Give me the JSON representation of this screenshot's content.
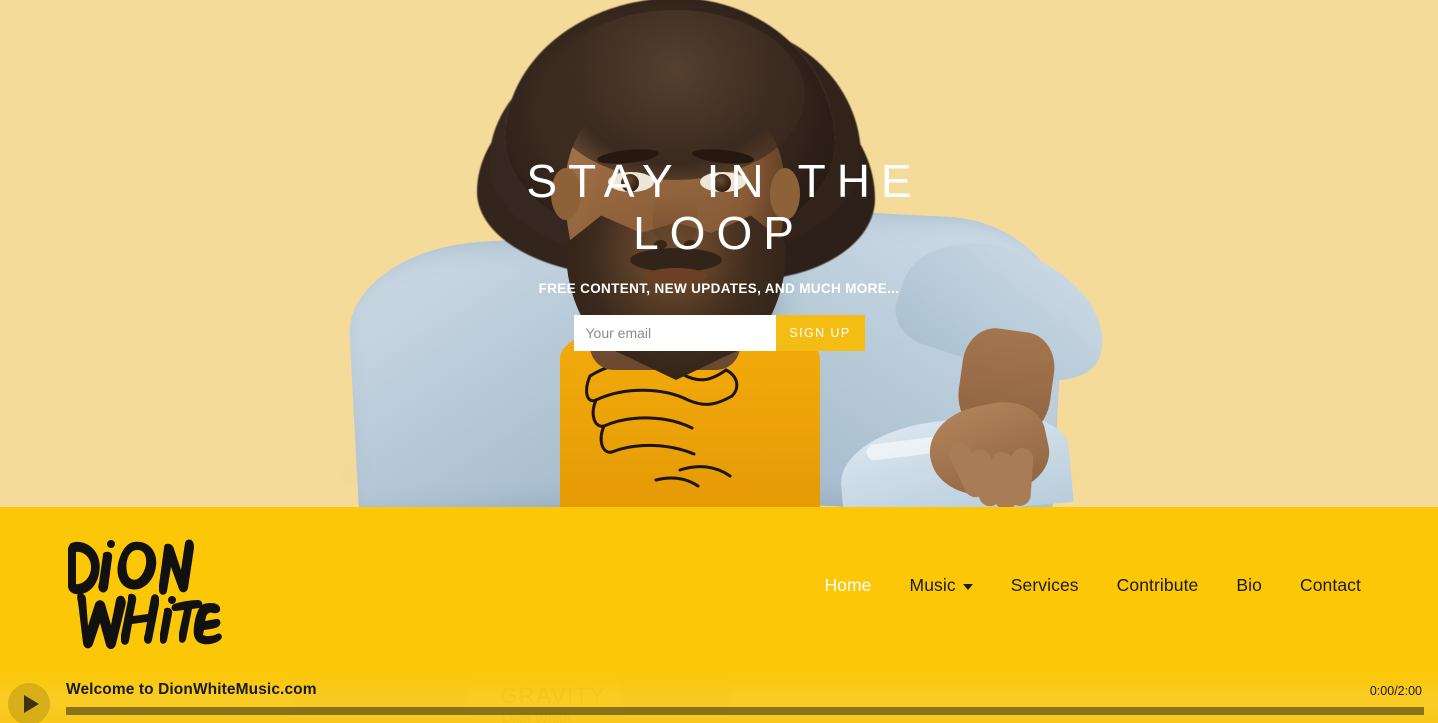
{
  "site": {
    "brand_name": "DION WHITE",
    "brand_line1": "DION",
    "brand_line2": "WHITE"
  },
  "hero": {
    "title": "STAY IN THE LOOP",
    "subtitle": "FREE CONTENT, NEW UPDATES, AND MUCH MORE...",
    "email_placeholder": "Your email",
    "email_value": "",
    "signup_label": "SIGN UP",
    "background_color": "#f5db9a"
  },
  "nav": {
    "items": [
      {
        "label": "Home",
        "active": true,
        "has_dropdown": false
      },
      {
        "label": "Music",
        "active": false,
        "has_dropdown": true
      },
      {
        "label": "Services",
        "active": false,
        "has_dropdown": false
      },
      {
        "label": "Contribute",
        "active": false,
        "has_dropdown": false
      },
      {
        "label": "Bio",
        "active": false,
        "has_dropdown": false
      },
      {
        "label": "Contact",
        "active": false,
        "has_dropdown": false
      }
    ],
    "bar_color": "#fcc707",
    "active_color": "#ffffff",
    "link_color": "#1b1b1b"
  },
  "behind_player": {
    "track_title": "GRAVITY",
    "artist": "Dion White"
  },
  "player": {
    "now_playing": "Welcome to DionWhiteMusic.com",
    "time_display": "0:00/2:00",
    "current_time": "0:00",
    "duration": "2:00",
    "progress_percent": 0,
    "play_icon": "play-icon",
    "state": "paused"
  }
}
